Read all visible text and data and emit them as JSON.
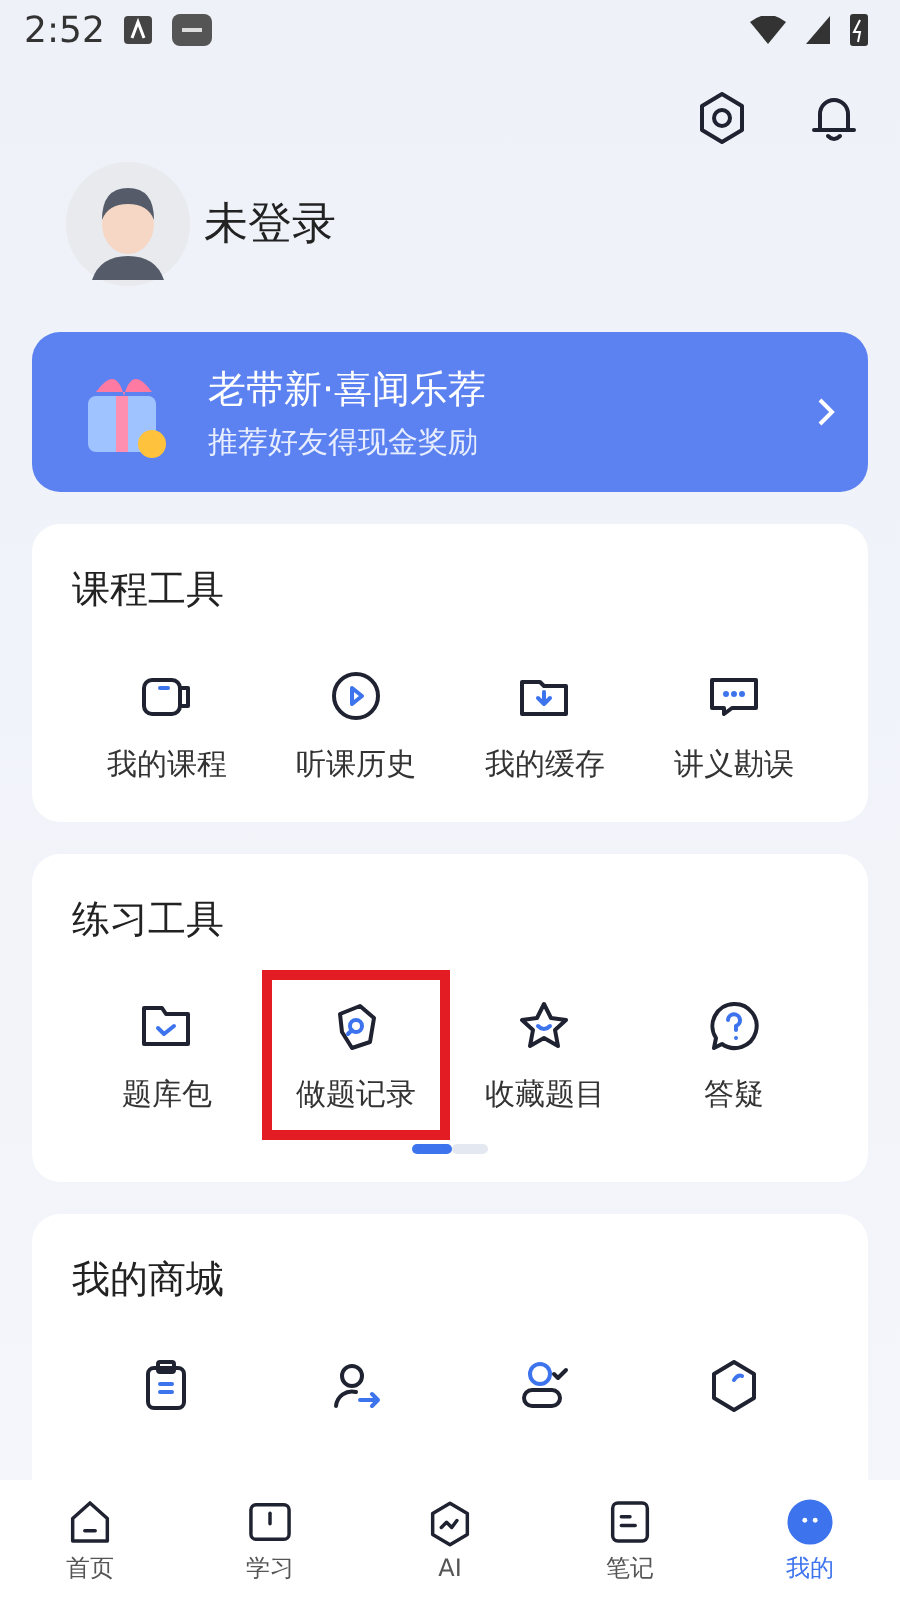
{
  "status_bar": {
    "time": "2:52"
  },
  "profile": {
    "name": "未登录"
  },
  "banner": {
    "title": "老带新·喜闻乐荐",
    "subtitle": "推荐好友得现金奖励"
  },
  "sections": [
    {
      "title": "课程工具",
      "items": [
        {
          "kind": "video",
          "label": "我的课程",
          "highlighted": false
        },
        {
          "kind": "play",
          "label": "听课历史",
          "highlighted": false
        },
        {
          "kind": "download",
          "label": "我的缓存",
          "highlighted": false
        },
        {
          "kind": "chat",
          "label": "讲义勘误",
          "highlighted": false
        }
      ]
    },
    {
      "title": "练习工具",
      "pager": true,
      "items": [
        {
          "kind": "folder",
          "label": "题库包",
          "highlighted": false
        },
        {
          "kind": "record",
          "label": "做题记录",
          "highlighted": true
        },
        {
          "kind": "star",
          "label": "收藏题目",
          "highlighted": false
        },
        {
          "kind": "question",
          "label": "答疑",
          "highlighted": false
        }
      ]
    },
    {
      "title": "我的商城",
      "items": [
        {
          "kind": "clipboard"
        },
        {
          "kind": "share"
        },
        {
          "kind": "user-check"
        },
        {
          "kind": "hexagon"
        }
      ]
    }
  ],
  "tabs": [
    {
      "kind": "home",
      "label": "首页",
      "selected": false
    },
    {
      "kind": "book",
      "label": "学习",
      "selected": false
    },
    {
      "kind": "ai",
      "label": "AI",
      "selected": false
    },
    {
      "kind": "note",
      "label": "笔记",
      "selected": false
    },
    {
      "kind": "me",
      "label": "我的",
      "selected": true
    }
  ]
}
